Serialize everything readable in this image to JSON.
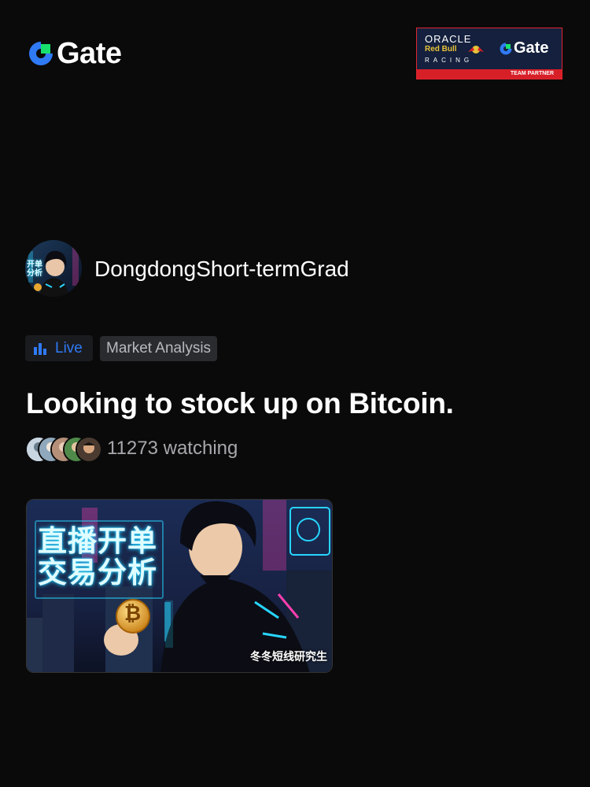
{
  "brand": {
    "name": "Gate",
    "accent": "#17e06e",
    "blue": "#2f7af5"
  },
  "partner_badge": {
    "oracle": "ORACLE",
    "red_bull": "Red Bull",
    "racing": "RACING",
    "gate": "Gate",
    "team_partner": "TEAM PARTNER"
  },
  "streamer": {
    "username": "DongdongShort-termGrad",
    "avatar_text": "开单分析"
  },
  "tags": {
    "live": "Live",
    "category": "Market Analysis"
  },
  "stream": {
    "title": "Looking to stock up on Bitcoin.",
    "watching": "11273 watching"
  },
  "thumbnail": {
    "line1": "直播开单",
    "line2": "交易分析",
    "caption": "冬冬短线研究生",
    "coin_symbol": "₿"
  }
}
